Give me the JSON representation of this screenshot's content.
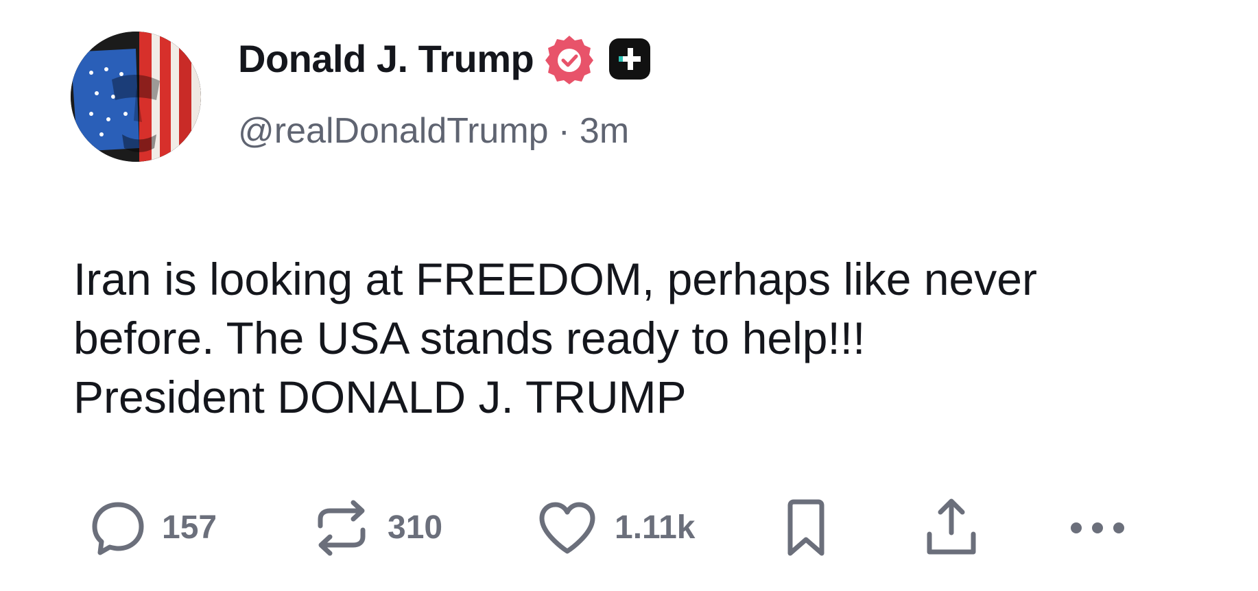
{
  "author": {
    "display_name": "Donald J. Trump",
    "handle": "@realDonaldTrump",
    "time_separator": "·",
    "timestamp": "3m",
    "verified_badge_icon": "verified-check-badge",
    "plus_badge_icon": "plus-badge",
    "avatar_icon": "avatar-flag-portrait"
  },
  "post": {
    "lines": [
      "Iran is looking at FREEDOM, perhaps like never",
      "before. The USA stands ready to help!!!",
      "President DONALD J. TRUMP"
    ]
  },
  "actions": {
    "reply": {
      "icon": "reply-bubble-icon",
      "count": "157"
    },
    "repost": {
      "icon": "repost-arrows-icon",
      "count": "310"
    },
    "like": {
      "icon": "heart-icon",
      "count": "1.11k"
    },
    "bookmark": {
      "icon": "bookmark-icon"
    },
    "share": {
      "icon": "share-upload-icon"
    },
    "more": {
      "icon": "more-dots-icon"
    }
  },
  "colors": {
    "text": "#14161c",
    "muted": "#5f6471",
    "icon": "#6b6f7b",
    "verified_badge": "#e8536a",
    "plus_badge": "#111111"
  }
}
